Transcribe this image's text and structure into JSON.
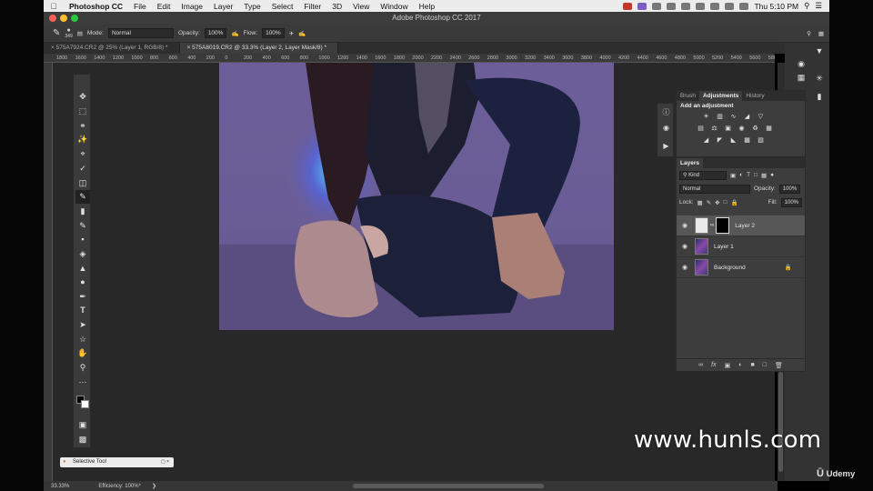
{
  "menubar": {
    "app_name": "Photoshop CC",
    "items": [
      "File",
      "Edit",
      "Image",
      "Layer",
      "Type",
      "Select",
      "Filter",
      "3D",
      "View",
      "Window",
      "Help"
    ],
    "clock": "Thu 5:10 PM"
  },
  "window": {
    "title": "Adobe Photoshop CC 2017"
  },
  "options": {
    "brush_size": "349",
    "mode_label": "Mode:",
    "mode_value": "Normal",
    "opacity_label": "Opacity:",
    "opacity_value": "100%",
    "flow_label": "Flow:",
    "flow_value": "100%"
  },
  "tabs": [
    {
      "label": "575A7924.CR2 @ 25% (Layer 1, RGB/8) *"
    },
    {
      "label": "575A8019.CR2 @ 33.3% (Layer 2, Layer Mask/8) *"
    }
  ],
  "ruler_ticks": [
    "1800",
    "1600",
    "1400",
    "1200",
    "1000",
    "800",
    "600",
    "400",
    "200",
    "0",
    "200",
    "400",
    "600",
    "800",
    "1000",
    "1200",
    "1400",
    "1600",
    "1800",
    "2000",
    "2200",
    "2400",
    "2600",
    "2800",
    "3000",
    "3200",
    "3400",
    "3600",
    "3800",
    "4000",
    "4200",
    "4400",
    "4600",
    "4800",
    "5000",
    "5200",
    "5400",
    "5600",
    "5800",
    "600"
  ],
  "panels": {
    "adjust_tabs": [
      "Brush",
      "Adjustments",
      "History"
    ],
    "adjust_title": "Add an adjustment",
    "layers_title": "Layers",
    "kind_label": "Kind",
    "blend_mode": "Normal",
    "opacity_label": "Opacity:",
    "opacity_value": "100%",
    "lock_label": "Lock:",
    "fill_label": "Fill:",
    "fill_value": "100%"
  },
  "layers": [
    {
      "name": "Layer 2"
    },
    {
      "name": "Layer 1"
    },
    {
      "name": "Background"
    }
  ],
  "status": {
    "zoom": "33.33%",
    "efficiency": "Efficiency: 100%*",
    "tool_hint": "Selective Tool"
  },
  "watermarks": {
    "site": "www.hunls.com",
    "brand": "Udemy"
  }
}
